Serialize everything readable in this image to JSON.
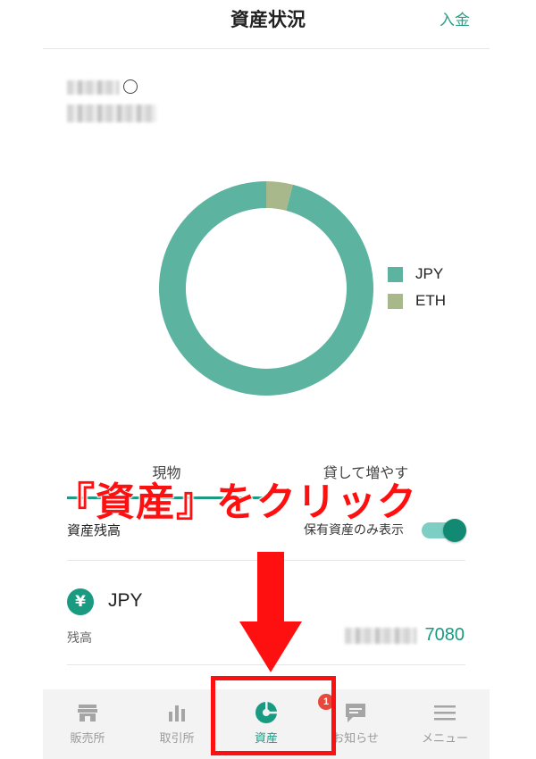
{
  "header": {
    "title": "資産状況",
    "action_label": "入金"
  },
  "chart_data": {
    "type": "pie",
    "title": "",
    "categories": [
      "JPY",
      "ETH"
    ],
    "values": [
      96,
      4
    ],
    "colors": [
      "#5bb3a0",
      "#a8b88a"
    ],
    "legend": "right"
  },
  "tabs": [
    {
      "label": "現物",
      "active": true
    },
    {
      "label": "貸して増やす",
      "active": false
    }
  ],
  "overlay": {
    "caption": "『資産』をクリック"
  },
  "balance_section": {
    "title": "資産残高",
    "toggle_label": "保有資産のみ表示",
    "toggle_on": true
  },
  "asset": {
    "icon_symbol": "¥",
    "name": "JPY",
    "balance_label": "残高",
    "balance_value": "7080"
  },
  "bottom_nav": [
    {
      "label": "販売所",
      "icon": "store-icon",
      "active": false
    },
    {
      "label": "取引所",
      "icon": "bar-chart-icon",
      "active": false
    },
    {
      "label": "資産",
      "icon": "pie-chart-icon",
      "active": true
    },
    {
      "label": "お知らせ",
      "icon": "message-icon",
      "active": false
    },
    {
      "label": "メニュー",
      "icon": "hamburger-menu-icon",
      "active": false
    }
  ],
  "notification_badge": "1",
  "colors": {
    "accent": "#1b9a82",
    "annotation_red": "#ff1010"
  }
}
